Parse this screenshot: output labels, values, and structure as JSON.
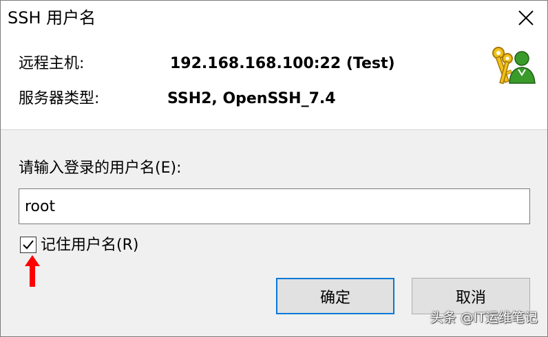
{
  "window": {
    "title": "SSH 用户名"
  },
  "info": {
    "remote_host_label": "远程主机:",
    "remote_host_value": "192.168.168.100:22 (Test)",
    "server_type_label": "服务器类型:",
    "server_type_value": "SSH2, OpenSSH_7.4"
  },
  "form": {
    "prompt_label": "请输入登录的用户名(E):",
    "username_value": "root",
    "remember_label": "记住用户名(R)",
    "remember_checked": true
  },
  "buttons": {
    "ok_label": "确定",
    "cancel_label": "取消"
  },
  "watermark": {
    "text": "头条 @IT运维笔记"
  },
  "icons": {
    "app_icon": "keys-user-icon",
    "close_icon": "close-icon",
    "annotation_arrow": "red-arrow-up-icon"
  },
  "colors": {
    "form_background": "#f0f0f0",
    "default_button_border": "#0078d7",
    "annotation_arrow": "#ff0000"
  }
}
